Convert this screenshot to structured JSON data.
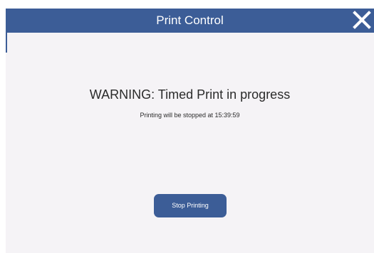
{
  "dialog": {
    "title": "Print Control",
    "close_icon": "close-icon",
    "warning": "WARNING: Timed Print in progress",
    "status_text": "Printing will be stopped at 15:39:59",
    "stop_button_label": "Stop Printing"
  },
  "colors": {
    "titlebar": "#3c5d97",
    "button": "#3c5d97",
    "background": "#f5f3f6",
    "text": "#2b2b2b"
  }
}
